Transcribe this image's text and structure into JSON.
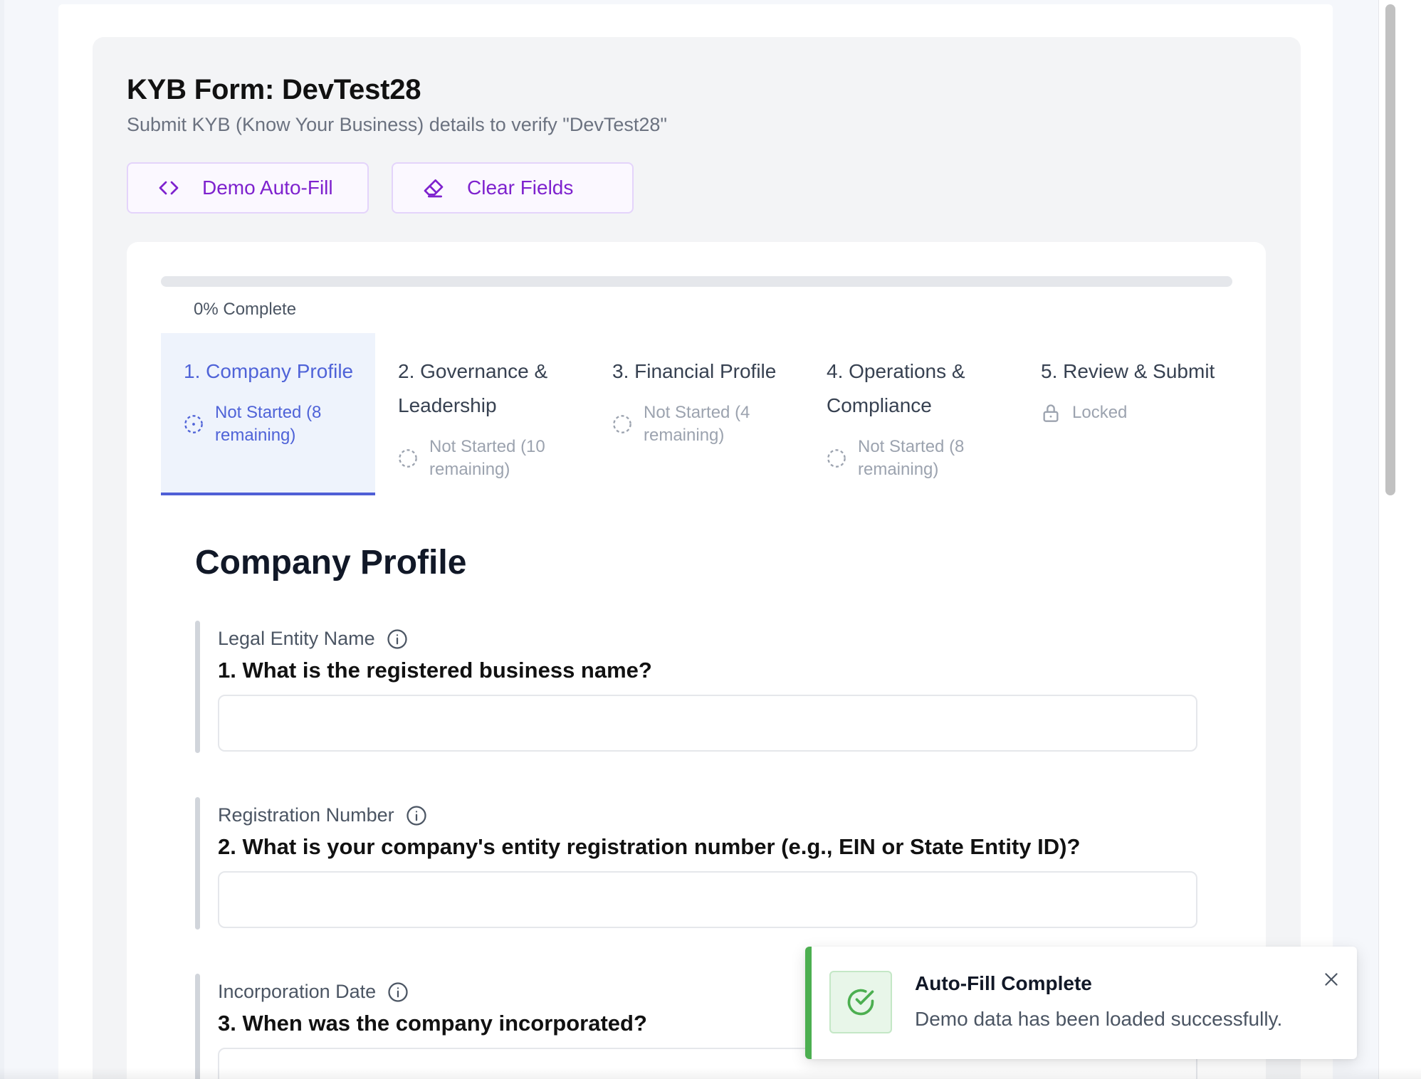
{
  "header": {
    "title": "KYB Form: DevTest28",
    "subtitle": "Submit KYB (Know Your Business) details to verify \"DevTest28\""
  },
  "actions": {
    "demo_autofill_label": "Demo Auto-Fill",
    "demo_autofill_icon": "code-icon",
    "clear_fields_label": "Clear Fields",
    "clear_fields_icon": "eraser-icon"
  },
  "progress": {
    "percent": 0,
    "label": "0% Complete"
  },
  "steps": [
    {
      "title": "1. Company Profile",
      "status": "Not Started (8 remaining)",
      "state": "active",
      "icon": "dashed-circle-dot-icon"
    },
    {
      "title": "2. Governance & Leadership",
      "status": "Not Started (10 remaining)",
      "state": "inactive",
      "icon": "dashed-circle-icon"
    },
    {
      "title": "3. Financial Profile",
      "status": "Not Started (4 remaining)",
      "state": "inactive",
      "icon": "dashed-circle-icon"
    },
    {
      "title": "4. Operations & Compliance",
      "status": "Not Started (8 remaining)",
      "state": "inactive",
      "icon": "dashed-circle-icon"
    },
    {
      "title": "5. Review & Submit",
      "status": "Locked",
      "state": "locked",
      "icon": "lock-icon"
    }
  ],
  "section": {
    "title": "Company Profile"
  },
  "questions": [
    {
      "label": "Legal Entity Name",
      "question": "1. What is the registered business name?",
      "value": "",
      "placeholder": ""
    },
    {
      "label": "Registration Number",
      "question": "2. What is your company's entity registration number (e.g., EIN or State Entity ID)?",
      "value": "",
      "placeholder": ""
    },
    {
      "label": "Incorporation Date",
      "question": "3. When was the company incorporated?",
      "value": "",
      "placeholder": ""
    }
  ],
  "toast": {
    "title": "Auto-Fill Complete",
    "message": "Demo data has been loaded successfully.",
    "icon": "check-circle-icon",
    "accent_color": "#4caf50"
  },
  "colors": {
    "primary": "#4f63d8",
    "action_purple": "#7e22ce",
    "success_green": "#4caf50"
  }
}
